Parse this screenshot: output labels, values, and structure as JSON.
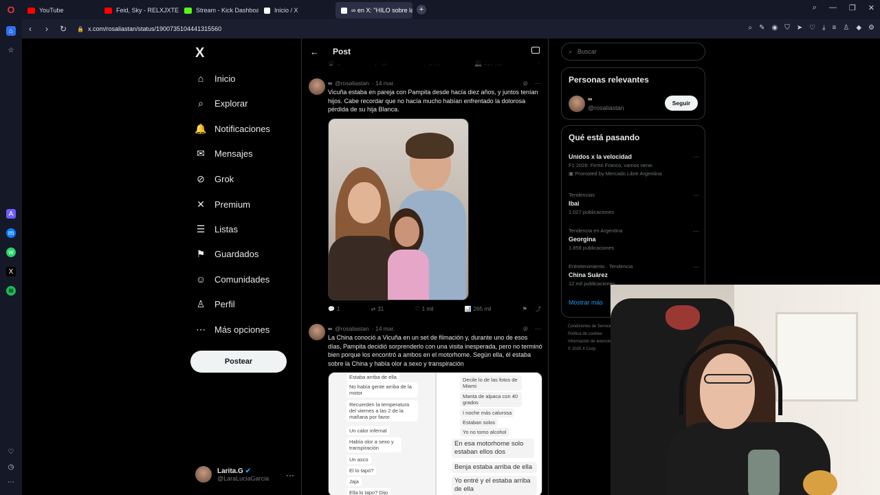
{
  "browser": {
    "logo": "O",
    "tabs": [
      {
        "label": "YouTube",
        "color": "#ff0000"
      },
      {
        "label": "Feid, Sky - RELXJXTE - Yo",
        "color": "#ff0000"
      },
      {
        "label": "Stream - Kick Dashboard",
        "color": "#53fc18"
      },
      {
        "label": "Inicio / X",
        "color": "#ffffff"
      },
      {
        "label": "∞ en X: \"HILO sobre las r",
        "color": "#ffffff"
      }
    ],
    "add_tab": "+",
    "url": "x.com/rosaliastan/status/1900735104441315560"
  },
  "nav": {
    "logo": "X",
    "items": [
      {
        "label": "Inicio",
        "icon": "home-icon",
        "glyph": "⌂"
      },
      {
        "label": "Explorar",
        "icon": "search-icon",
        "glyph": "⌕"
      },
      {
        "label": "Notificaciones",
        "icon": "bell-icon",
        "glyph": "🔔"
      },
      {
        "label": "Mensajes",
        "icon": "mail-icon",
        "glyph": "✉"
      },
      {
        "label": "Grok",
        "icon": "grok-icon",
        "glyph": "⊘"
      },
      {
        "label": "Premium",
        "icon": "x-premium-icon",
        "glyph": "✕"
      },
      {
        "label": "Listas",
        "icon": "list-icon",
        "glyph": "☰"
      },
      {
        "label": "Guardados",
        "icon": "bookmark-icon",
        "glyph": "⚑"
      },
      {
        "label": "Comunidades",
        "icon": "communities-icon",
        "glyph": "☺"
      },
      {
        "label": "Perfil",
        "icon": "profile-icon",
        "glyph": "♙"
      },
      {
        "label": "Más opciones",
        "icon": "more-options-icon",
        "glyph": "⋯"
      }
    ],
    "post_button": "Postear",
    "account": {
      "name": "Larita.G",
      "handle": "@LaraLuciaGarcia",
      "more": "···"
    }
  },
  "main": {
    "title": "Post",
    "back": "←",
    "prev_actions": {
      "replies": "1",
      "reposts": "39",
      "likes": "1 mil",
      "views": "210 mil"
    },
    "tweets": [
      {
        "name": "∞",
        "handle": "@rosaliastan",
        "date": "· 14 mar.",
        "text": "Vicuña estaba en pareja con Pampita desde hacía diez años, y juntos tenían hijos. Cabe recordar que no hacía mucho habían enfrentado la dolorosa pérdida de su hija Blanca.",
        "replies": "1",
        "reposts": "31",
        "likes": "1 mil",
        "views": "265 mil"
      },
      {
        "name": "∞",
        "handle": "@rosaliastan",
        "date": "· 14 mar.",
        "text": "La China conoció a Vicuña en un set de filmación y, durante uno de esos días, Pampita decidió sorprenderlo con una visita inesperada, pero no terminó bien porque los encontró a ambos en el motorhome. Según ella, él estaba sobre la China y había olor a sexo y transpiración",
        "chat_left": [
          "Estaba arriba de ella",
          "No había gente arriba de la motor",
          "Recuerden la temperatura del viernes a las 2 de la mañana por favor",
          "Un calor infernal",
          "Había olor a sexo y transpiración",
          "Un asco",
          "El lo tapó?",
          "Jaja",
          "Ella lo tapo? Dijo"
        ],
        "chat_right": [
          "Decile lo de las fotos de Miami",
          "Manta de alpaca con 40 grados",
          "I noche más calurosa",
          "Estaban solos",
          "Yo no tomo alcohol",
          "En esa motorhome solo estaban ellos dos",
          "Benja estaba arriba de ella",
          "Yo entré y el estaba arriba de ella"
        ]
      }
    ]
  },
  "right": {
    "search_placeholder": "Buscar",
    "relevant": {
      "title": "Personas relevantes",
      "name": "∞",
      "handle": "@rosaliastan",
      "follow": "Seguir"
    },
    "trends": {
      "title": "Qué está pasando",
      "items": [
        {
          "category": "",
          "title": "Unidos x la velocidad",
          "sub": "F1 2026: Firmó Franco, vamos nene.",
          "sub2": "Promoted by Mercado Libre Argentina"
        },
        {
          "category": "Tendencias",
          "title": "Ibai",
          "sub": "1.027 publicaciones",
          "sub2": ""
        },
        {
          "category": "Tendencia en Argentina",
          "title": "Georgina",
          "sub": "1.858 publicaciones",
          "sub2": ""
        },
        {
          "category": "Entretenimiento · Tendencia",
          "title": "China Suárez",
          "sub": "12 mil publicaciones",
          "sub2": ""
        }
      ],
      "show_more": "Mostrar más"
    },
    "footer": [
      "Condiciones de Servicio",
      "Política de cookies",
      "Información de anuncios",
      "© 2025 X Corp."
    ]
  }
}
